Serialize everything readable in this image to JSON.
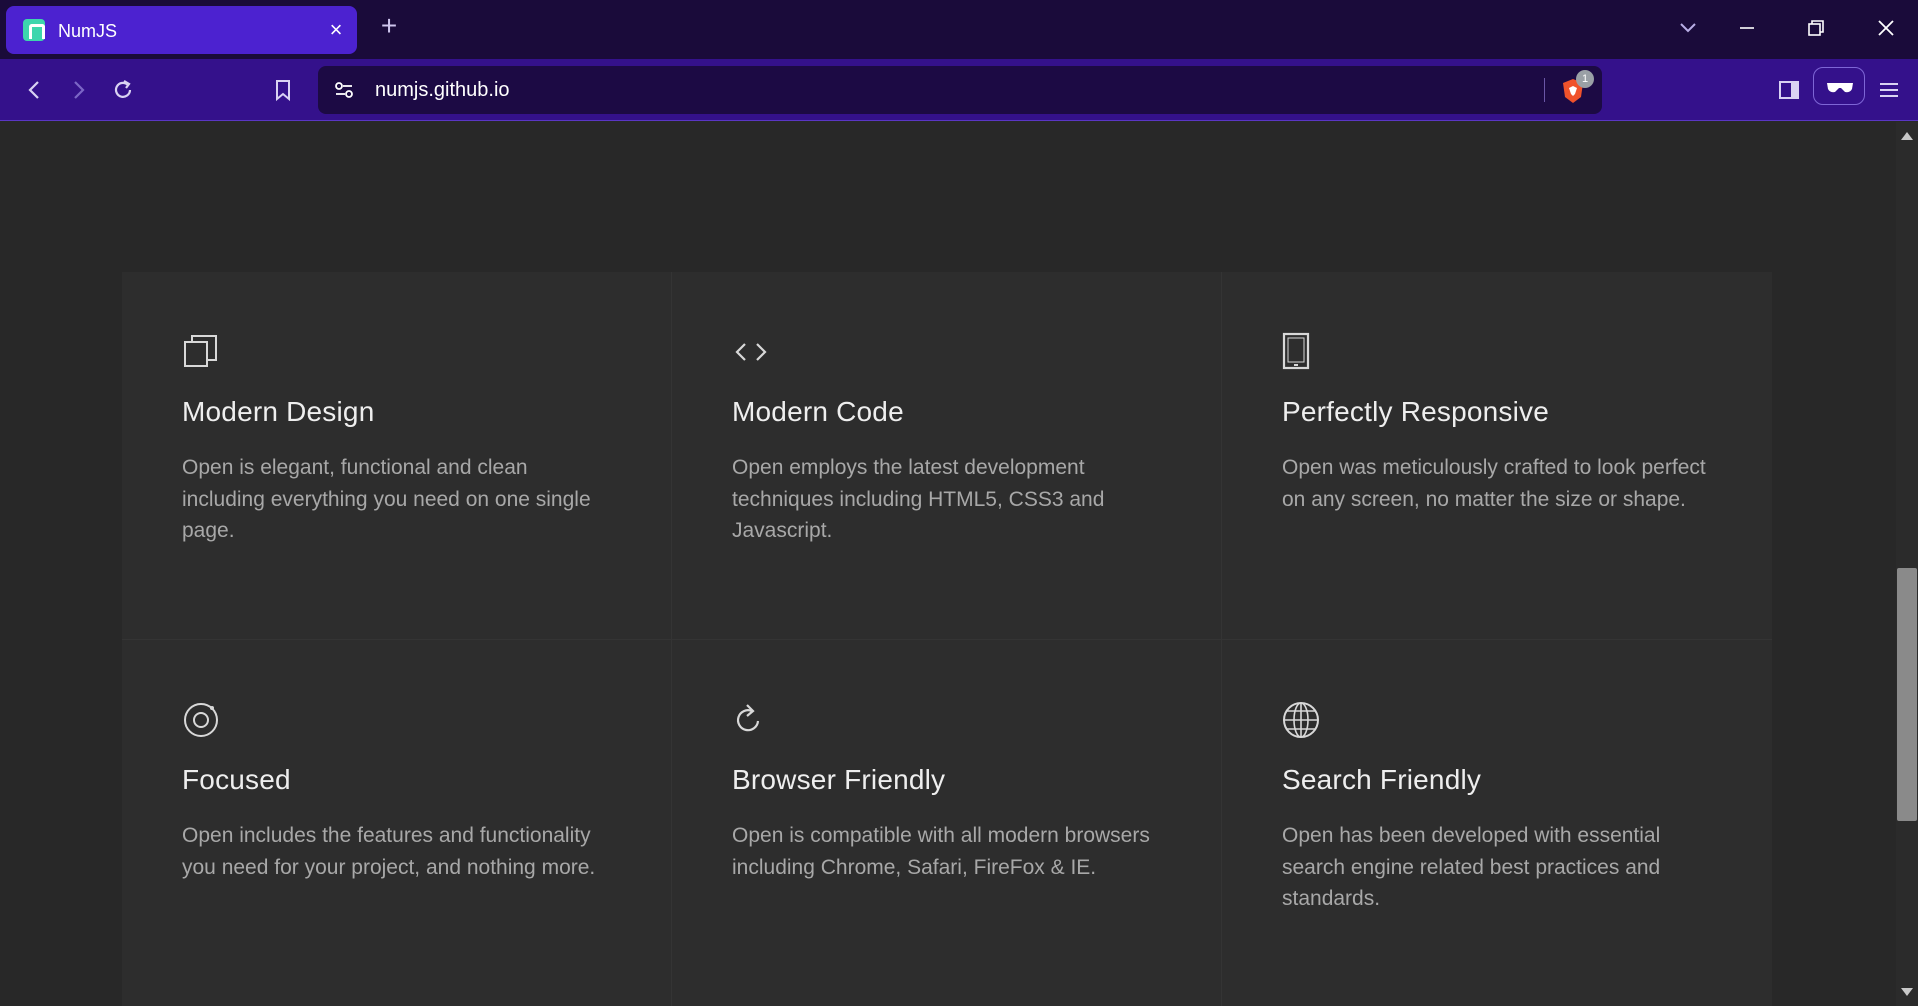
{
  "browser": {
    "tab_title": "NumJS",
    "tab_close": "×",
    "new_tab": "+",
    "url": "numjs.github.io",
    "shield_badge": "1",
    "accent": "#4c22d0",
    "toolbar_color": "#34118b"
  },
  "features": [
    {
      "icon": "copy-icon",
      "title": "Modern Design",
      "text": "Open is elegant, functional and clean including everything you need on one single page."
    },
    {
      "icon": "code-icon",
      "title": "Modern Code",
      "text": "Open employs the latest development techniques including HTML5, CSS3 and Javascript."
    },
    {
      "icon": "tablet-icon",
      "title": "Perfectly Responsive",
      "text": "Open was meticulously crafted to look perfect on any screen, no matter the size or shape."
    },
    {
      "icon": "target-icon",
      "title": "Focused",
      "text": "Open includes the features and functionality you need for your project, and nothing more."
    },
    {
      "icon": "refresh-icon",
      "title": "Browser Friendly",
      "text": "Open is compatible with all modern browsers including Chrome, Safari, FireFox & IE."
    },
    {
      "icon": "globe-icon",
      "title": "Search Friendly",
      "text": "Open has been developed with essential search engine related best practices and standards."
    }
  ],
  "scroll": {
    "position_fraction": 0.72,
    "visible_fraction": 0.3
  }
}
